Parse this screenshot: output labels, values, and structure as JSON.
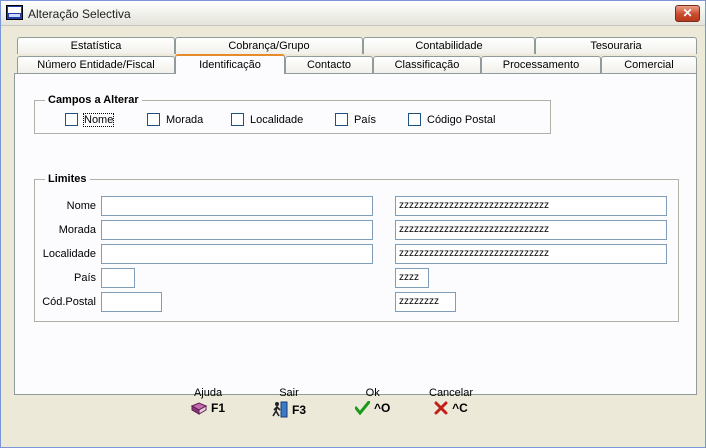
{
  "window": {
    "title": "Alteração Selectiva"
  },
  "tabs": {
    "row_back": [
      {
        "label": "Estatística"
      },
      {
        "label": "Cobrança/Grupo"
      },
      {
        "label": "Contabilidade"
      },
      {
        "label": "Tesouraria"
      }
    ],
    "row_front": [
      {
        "label": "Número Entidade/Fiscal"
      },
      {
        "label": "Identificação",
        "active": true
      },
      {
        "label": "Contacto"
      },
      {
        "label": "Classificação"
      },
      {
        "label": "Processamento"
      },
      {
        "label": "Comercial"
      }
    ]
  },
  "campos": {
    "legend": "Campos a Alterar",
    "options": [
      {
        "label": "Nome",
        "checked": false
      },
      {
        "label": "Morada",
        "checked": false
      },
      {
        "label": "Localidade",
        "checked": false
      },
      {
        "label": "País",
        "checked": false
      },
      {
        "label": "Código Postal",
        "checked": false
      }
    ]
  },
  "limites": {
    "legend": "Limites",
    "rows": [
      {
        "label": "Nome",
        "from": "",
        "to": "zzzzzzzzzzzzzzzzzzzzzzzzzzzzzz"
      },
      {
        "label": "Morada",
        "from": "",
        "to": "zzzzzzzzzzzzzzzzzzzzzzzzzzzzzz"
      },
      {
        "label": "Localidade",
        "from": "",
        "to": "zzzzzzzzzzzzzzzzzzzzzzzzzzzzzz"
      },
      {
        "label": "País",
        "from": "",
        "to": "zzzz"
      },
      {
        "label": "Cód.Postal",
        "from": "",
        "to": "zzzzzzzz"
      }
    ]
  },
  "footer": {
    "ajuda": {
      "label": "Ajuda",
      "key": "F1",
      "icon": "help-book-icon"
    },
    "sair": {
      "label": "Sair",
      "key": "F3",
      "icon": "exit-door-icon"
    },
    "ok": {
      "label": "Ok",
      "key": "^O",
      "icon": "checkmark-icon"
    },
    "cancelar": {
      "label": "Cancelar",
      "key": "^C",
      "icon": "cross-icon"
    }
  },
  "colors": {
    "accent_tab": "#e68b2c",
    "ok_green": "#1a9a1a",
    "cancel_red": "#c0201a"
  }
}
